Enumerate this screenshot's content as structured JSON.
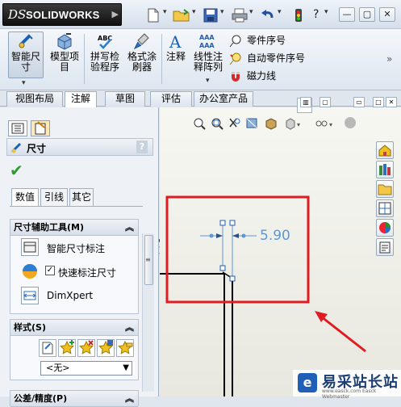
{
  "app": {
    "logo_ds": "DS",
    "brand": "SOLIDWORKS"
  },
  "ribbon": {
    "smart_dimension": "智能尺\n寸",
    "model_items": "模型项\n目",
    "spell_check": "拼写检\n验程序",
    "format_painter": "格式涂\n刷器",
    "note": "注释",
    "linear_note_pattern": "线性注\n释阵列",
    "balloon": "零件序号",
    "auto_balloon": "自动零件序号",
    "magnetic_line": "磁力线"
  },
  "tabs": [
    "视图布局",
    "注解",
    "草图",
    "评估",
    "办公室产品"
  ],
  "active_tab": "注解",
  "panel": {
    "title": "尺寸",
    "help": "?",
    "subtabs": [
      "数值",
      "引线",
      "其它"
    ],
    "group1": {
      "title": "尺寸辅助工具(M)",
      "items": [
        "智能尺寸标注",
        "快速标注尺寸",
        "DimXpert"
      ],
      "quick_dim_checked": true
    },
    "group2": {
      "title": "样式(S)",
      "select_value": "<无>"
    },
    "group3": {
      "title": "公差/精度(P)"
    }
  },
  "graphics": {
    "dimension_value": "5.90",
    "annotation_color": "#e11b22"
  },
  "watermark": {
    "text": "易采站长站",
    "sub": "www.easck.com  Easck Webmaster"
  }
}
